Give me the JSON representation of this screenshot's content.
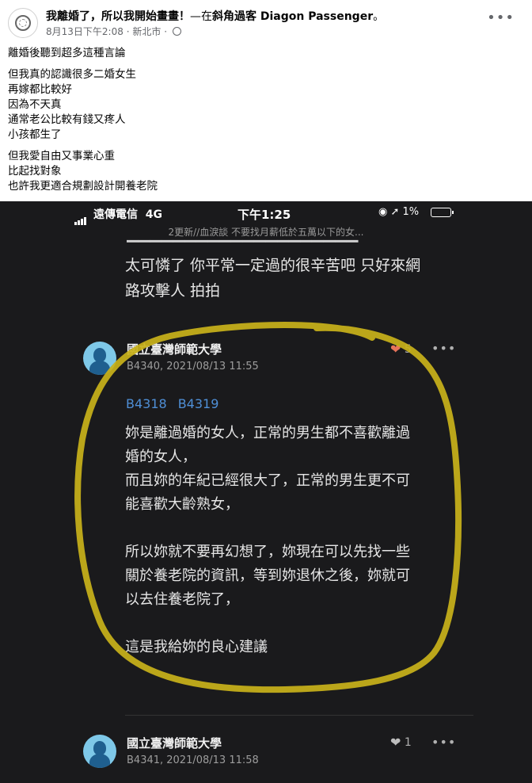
{
  "post": {
    "title": "我離婚了，所以我開始畫畫！",
    "title_sep": "—",
    "location_prefix": "在",
    "location": "斜角過客 Diagon Passenger",
    "location_suffix": "。",
    "date": "8月13日下午2:08",
    "place": "新北市",
    "privacy_icon": "globe-icon",
    "more_icon": "more-dots-icon",
    "paragraphs": [
      [
        "離婚後聽到超多這種言論"
      ],
      [
        "但我真的認識很多二婚女生",
        "再嫁都比較好",
        "因為不天真",
        "通常老公比較有錢又疼人",
        "小孩都生了"
      ],
      [
        "但我愛自由又事業心重",
        "比起找對象",
        "也許我更適合規劃設計開養老院"
      ]
    ]
  },
  "screenshot": {
    "status_bar": {
      "carrier": "遠傳電信",
      "network": "4G",
      "time": "下午1:25",
      "battery": "1%"
    },
    "thread_title": "2更新//血淚談  不要找月薪低於五萬以下的女...",
    "previous_comment_lines": [
      "太可憐了 你平常一定過的很辛苦吧 只好來網",
      "路攻擊人 拍拍"
    ],
    "comments": [
      {
        "name": "國立臺灣師範大學",
        "meta": "B4340, 2021/08/13 11:55",
        "likes": "5",
        "reply_tags": [
          "B4318",
          "B4319"
        ],
        "body": [
          "妳是離過婚的女人，正常的男生都不喜歡離過",
          "婚的女人，",
          "而且妳的年紀已經很大了，正常的男生更不可",
          "能喜歡大齡熟女，",
          "",
          "所以妳就不要再幻想了，妳現在可以先找一些",
          "關於養老院的資訊，等到妳退休之後，妳就可",
          "以去住養老院了，",
          "",
          "這是我給妳的良心建議"
        ]
      },
      {
        "name": "國立臺灣師範大學",
        "meta": "B4341, 2021/08/13 11:58",
        "likes": "1"
      }
    ],
    "highlight_color": "#c9b21a"
  }
}
